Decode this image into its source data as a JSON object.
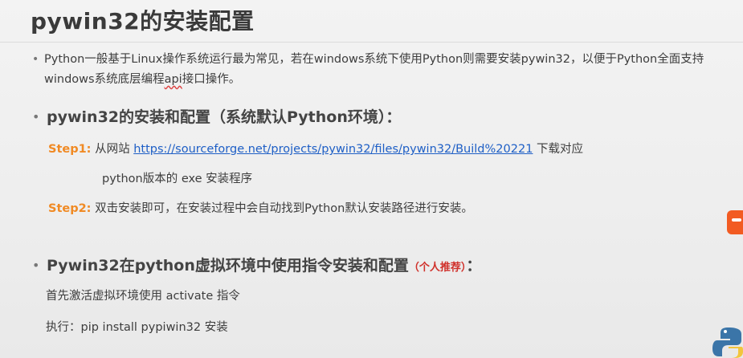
{
  "title": "pywin32的安装配置",
  "intro": {
    "before_api": "Python一般基于Linux操作系统运行最为常见，若在windows系统下使用Python则需要安装pywin32，以便于Python全面支持windows系统底层编程",
    "api": "api",
    "after_api": "接口操作。"
  },
  "section1": {
    "heading": "pywin32的安装和配置（系统默认Python环境）：",
    "step1": {
      "label": "Step1:",
      "prefix": " 从网站 ",
      "url": "https://sourceforge.net/projects/pywin32/files/pywin32/Build%20221",
      "suffix": " 下载对应",
      "line2": "python版本的 exe 安装程序"
    },
    "step2": {
      "label": "Step2:",
      "text": " 双击安装即可，在安装过程中会自动找到Python默认安装路径进行安装。"
    }
  },
  "section2": {
    "heading": "Pywin32在python虚拟环境中使用指令安装和配置",
    "recommend": "（个人推荐）",
    "colon": "：",
    "line1": "首先激活虚拟环境使用 activate 指令",
    "line2": "执行：pip install pypiwin32 安装"
  },
  "icons": [
    "bullet-dot",
    "side-app-icon",
    "python-icon"
  ],
  "colors": {
    "step_label": "#f08a24",
    "link": "#1e5fc6",
    "recommend": "#d0302a",
    "title": "#3a3a3a"
  }
}
